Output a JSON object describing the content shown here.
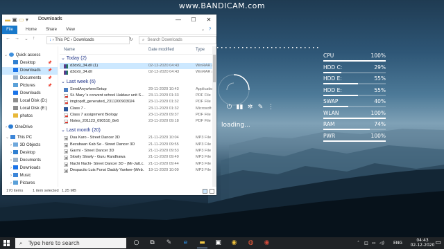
{
  "watermark": "www.BANDICAM.com",
  "explorer": {
    "title": "Downloads",
    "ribbon_tabs": [
      "File",
      "Home",
      "Share",
      "View"
    ],
    "address": [
      "This PC",
      "Downloads"
    ],
    "search_placeholder": "Search Downloads",
    "columns": {
      "name": "Name",
      "date": "Date modified",
      "type": "Type"
    },
    "nav": {
      "quick_access": "Quick access",
      "items": [
        {
          "label": "Desktop",
          "icon": "desktop-icon",
          "pinned": true
        },
        {
          "label": "Downloads",
          "icon": "download-icon",
          "pinned": true,
          "selected": true
        },
        {
          "label": "Documents",
          "icon": "documents-icon",
          "pinned": true
        },
        {
          "label": "Pictures",
          "icon": "pictures-icon",
          "pinned": true
        },
        {
          "label": "Downloads",
          "icon": "download-icon"
        },
        {
          "label": "Local Disk (D:)",
          "icon": "drive-icon"
        },
        {
          "label": "Local Disk (E:)",
          "icon": "drive-icon"
        },
        {
          "label": "photos",
          "icon": "folder-icon"
        },
        {
          "label": "OneDrive",
          "icon": "onedrive-icon"
        },
        {
          "label": "This PC",
          "icon": "pc-icon"
        },
        {
          "label": "3D Objects",
          "icon": "3d-objects-icon"
        },
        {
          "label": "Desktop",
          "icon": "desktop-icon"
        },
        {
          "label": "Documents",
          "icon": "documents-icon"
        },
        {
          "label": "Downloads",
          "icon": "download-icon"
        },
        {
          "label": "Music",
          "icon": "music-icon"
        },
        {
          "label": "Pictures",
          "icon": "pictures-icon"
        }
      ]
    },
    "groups": [
      {
        "label": "Today (2)",
        "files": [
          {
            "name": "d3dx9_34.dll (1)",
            "date": "02-12-2020 04:43",
            "type": "WinRAR a",
            "icon": "winrar-icon",
            "selected": true
          },
          {
            "name": "d3dx9_34.dll",
            "date": "02-12-2020 04:43",
            "type": "WinRAR a",
            "icon": "winrar-icon"
          }
        ]
      },
      {
        "label": "Last week (6)",
        "files": [
          {
            "name": "SendAnywhereSetup",
            "date": "29-11-2020 10:43",
            "type": "Applicatio",
            "icon": "application-icon"
          },
          {
            "name": "St. Mary 's convent school Haldaur unit S...",
            "date": "23-11-2020 01:33",
            "type": "PDF File",
            "icon": "pdf-icon"
          },
          {
            "name": "imgtopdf_generated_2311200903024",
            "date": "23-11-2020 01:32",
            "type": "PDF File",
            "icon": "pdf-icon"
          },
          {
            "name": "Class 7 -",
            "date": "23-11-2020 01:32",
            "type": "Microsoft",
            "icon": "word-icon"
          },
          {
            "name": "Class 7 assignment Biology",
            "date": "23-11-2020 09:37",
            "type": "PDF File",
            "icon": "pdf-icon"
          },
          {
            "name": "Notes_201123_090510_8e6",
            "date": "23-11-2020 09:18",
            "type": "PDF File",
            "icon": "pdf-icon"
          }
        ]
      },
      {
        "label": "Last month (20)",
        "files": [
          {
            "name": "Dua Karo - Street Dancer 3D",
            "date": "21-11-2020 10:04",
            "type": "MP3 File",
            "icon": "audio-icon"
          },
          {
            "name": "Bezubaan Kab Se - Street Dancer 3D",
            "date": "21-11-2020 09:55",
            "type": "MP3 File",
            "icon": "audio-icon"
          },
          {
            "name": "Garmi - Street Dancer 3D",
            "date": "21-11-2020 09:53",
            "type": "MP3 File",
            "icon": "audio-icon"
          },
          {
            "name": "Slowly Slowly - Guru Randhawa",
            "date": "21-11-2020 09:49",
            "type": "MP3 File",
            "icon": "audio-icon"
          },
          {
            "name": "Nachi Nachi- Street Dancer 3D - (Mr-Jatt.c...",
            "date": "21-11-2020 09:44",
            "type": "MP3 File",
            "icon": "audio-icon"
          },
          {
            "name": "Despacito Luis Fonsi Daddy Yankee-(Web...",
            "date": "19-11-2020 10:09",
            "type": "MP3 File",
            "icon": "audio-icon"
          }
        ]
      }
    ],
    "status": {
      "count": "170 items",
      "selected": "1 item selected",
      "size": "1.25 MB"
    }
  },
  "meters": [
    {
      "label": "CPU",
      "value": "100%",
      "fraction": 1.0
    },
    {
      "label": "HDD C:",
      "value": "29%",
      "fraction": 0.29
    },
    {
      "label": "HDD E:",
      "value": "55%",
      "fraction": 0.55
    },
    {
      "label": "HDD E:",
      "value": "55%",
      "fraction": 0.55
    },
    {
      "label": "SWAP",
      "value": "40%",
      "fraction": 0.4
    },
    {
      "label": "WLAN",
      "value": "100%",
      "fraction": 1.0
    },
    {
      "label": "RAM",
      "value": "74%",
      "fraction": 0.74
    },
    {
      "label": "PWR",
      "value": "100%",
      "fraction": 1.0
    }
  ],
  "loading_text": "loading...",
  "taskbar": {
    "search_placeholder": "Type here to search",
    "language": "ENG",
    "time": "04:43",
    "date": "02-12-2020"
  }
}
